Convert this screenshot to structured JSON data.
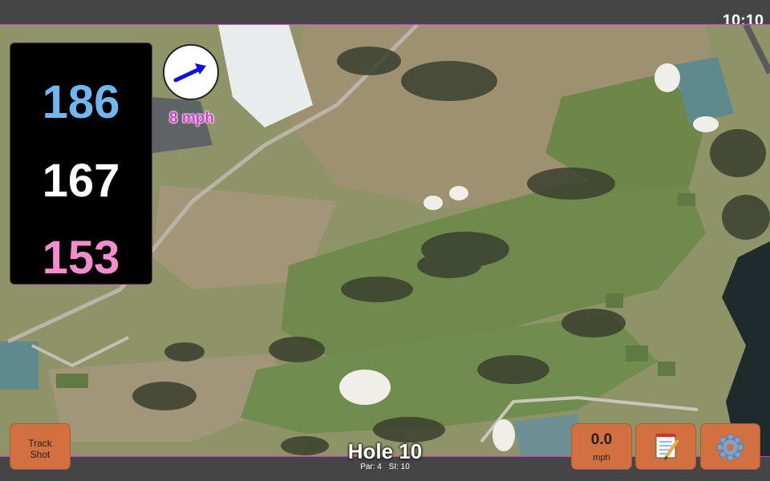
{
  "status_bar": {
    "time": "10:10"
  },
  "distances": {
    "back": "186",
    "middle": "167",
    "front": "153"
  },
  "wind": {
    "speed": "8 mph",
    "direction_icon": "arrow-right-icon"
  },
  "hole": {
    "title": "Hole 10",
    "par": "Par: 4",
    "stroke_index": "SI: 10"
  },
  "buttons": {
    "track_line1": "Track",
    "track_line2": "Shot",
    "speed_value": "0.0",
    "speed_unit": "mph",
    "notes_icon": "notepad-icon",
    "settings_icon": "gear-icon"
  },
  "colors": {
    "back_distance": "#6fb7f3",
    "middle_distance": "#ffffff",
    "front_distance": "#f58ccd",
    "wind_text": "#d63ad0",
    "button": "#d2703f",
    "wind_arrow": "#1111dd"
  }
}
